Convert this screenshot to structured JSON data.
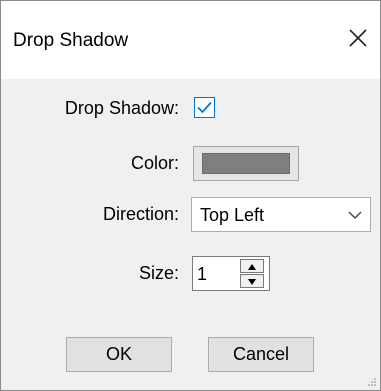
{
  "dialog": {
    "title": "Drop Shadow",
    "close_icon": "close-icon"
  },
  "fields": {
    "drop_shadow_label": "Drop Shadow:",
    "drop_shadow_checked": true,
    "color_label": "Color:",
    "color_value": "#7f7f7f",
    "direction_label": "Direction:",
    "direction_value": "Top Left",
    "size_label": "Size:",
    "size_value": "1"
  },
  "buttons": {
    "ok_label": "OK",
    "cancel_label": "Cancel"
  },
  "colors": {
    "accent": "#0078d7",
    "dialog_background": "#f0f0f0",
    "title_background": "#ffffff"
  }
}
